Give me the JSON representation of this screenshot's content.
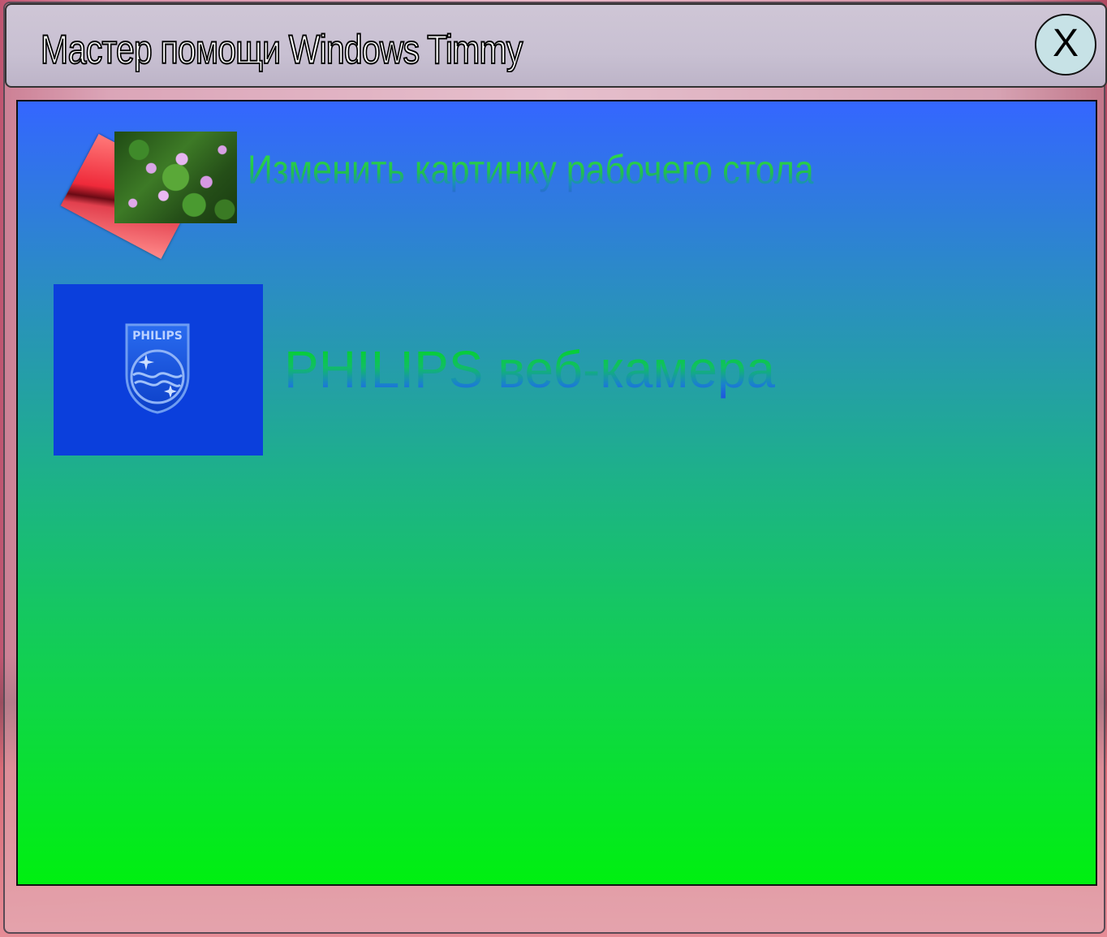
{
  "window": {
    "title": "Мастер помощи Windows Timmy",
    "close_label": "X"
  },
  "items": [
    {
      "label": "Изменить картинку рабочего стола",
      "icon": "wallpaper-photos-icon"
    },
    {
      "label": "PHILIPS веб-камера",
      "icon": "philips-logo-icon",
      "logo_text": "PHILIPS"
    }
  ],
  "colors": {
    "panel_top": "#3466ff",
    "panel_bottom": "#00f010",
    "titlebar": "#c8c0d2",
    "close_button": "#c7e2e6",
    "philips_blue": "#0b3fdc"
  }
}
